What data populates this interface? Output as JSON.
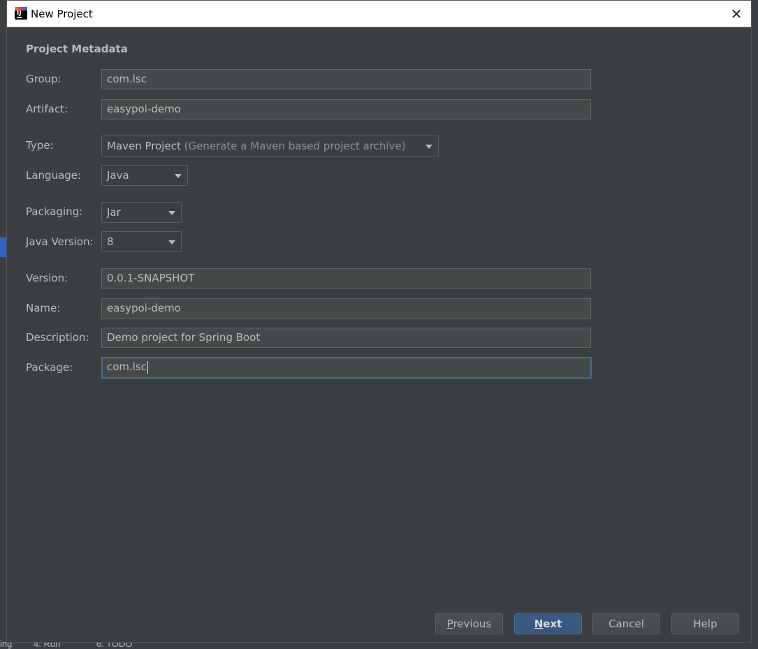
{
  "window": {
    "title": "New Project",
    "close_glyph": "✕"
  },
  "section": {
    "title": "Project Metadata"
  },
  "fields": {
    "group": {
      "label": "Group:",
      "value": "com.lsc"
    },
    "artifact": {
      "label": "Artifact:",
      "value": "easypoi-demo"
    },
    "type": {
      "label": "Type:",
      "value": "Maven Project",
      "hint": "(Generate a Maven based project archive)"
    },
    "language": {
      "label": "Language:",
      "value": "Java"
    },
    "packaging": {
      "label": "Packaging:",
      "value": "Jar"
    },
    "java_version": {
      "label": "Java Version:",
      "value": "8"
    },
    "version": {
      "label": "Version:",
      "value": "0.0.1-SNAPSHOT"
    },
    "name": {
      "label": "Name:",
      "value": "easypoi-demo"
    },
    "description": {
      "label": "Description:",
      "value": "Demo project for Spring Boot"
    },
    "package": {
      "label": "Package:",
      "value": "com.lsc"
    }
  },
  "buttons": {
    "previous": {
      "mnemonic": "P",
      "rest": "revious"
    },
    "next": {
      "mnemonic": "N",
      "rest": "ext"
    },
    "cancel": "Cancel",
    "help": "Help"
  },
  "background": {
    "run_tab": "4: Run",
    "todo_tab": "6: TODO",
    "left_fragment": "ing"
  },
  "colors": {
    "dialog_bg": "#3c3f41",
    "accent": "#365880",
    "focus_border": "#466d94"
  }
}
